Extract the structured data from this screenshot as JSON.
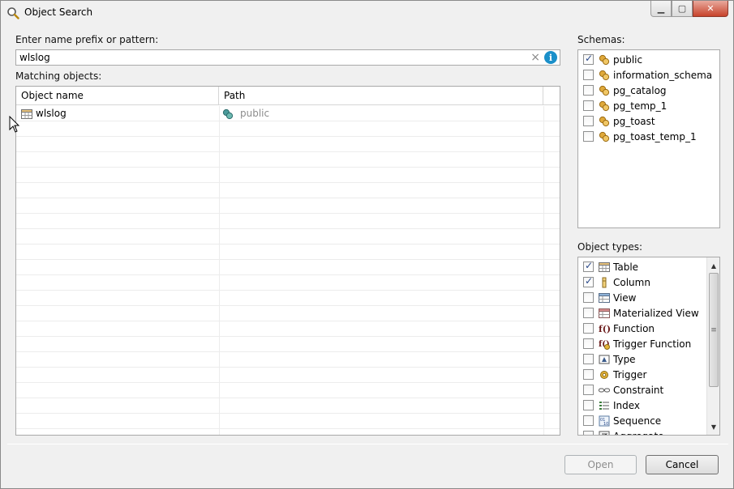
{
  "window": {
    "title": "Object Search"
  },
  "search": {
    "prompt_label": "Enter name prefix or pattern:",
    "value": "wlslog",
    "clear_symbol": "×",
    "info_symbol": "i"
  },
  "results": {
    "label": "Matching objects:",
    "columns": [
      "Object name",
      "Path"
    ],
    "rows": [
      {
        "name": "wlslog",
        "path": "public"
      }
    ]
  },
  "schemas": {
    "label": "Schemas:",
    "items": [
      {
        "label": "public",
        "checked": true,
        "icon": "schema-icon"
      },
      {
        "label": "information_schema",
        "checked": false,
        "icon": "schema-icon"
      },
      {
        "label": "pg_catalog",
        "checked": false,
        "icon": "schema-icon"
      },
      {
        "label": "pg_temp_1",
        "checked": false,
        "icon": "schema-icon"
      },
      {
        "label": "pg_toast",
        "checked": false,
        "icon": "schema-icon"
      },
      {
        "label": "pg_toast_temp_1",
        "checked": false,
        "icon": "schema-icon"
      }
    ]
  },
  "object_types": {
    "label": "Object types:",
    "items": [
      {
        "label": "Table",
        "checked": true,
        "icon": "table-icon"
      },
      {
        "label": "Column",
        "checked": true,
        "icon": "column-icon"
      },
      {
        "label": "View",
        "checked": false,
        "icon": "view-icon"
      },
      {
        "label": "Materialized View",
        "checked": false,
        "icon": "materialized-view-icon"
      },
      {
        "label": "Function",
        "checked": false,
        "icon": "function-icon"
      },
      {
        "label": "Trigger Function",
        "checked": false,
        "icon": "trigger-function-icon"
      },
      {
        "label": "Type",
        "checked": false,
        "icon": "type-icon"
      },
      {
        "label": "Trigger",
        "checked": false,
        "icon": "trigger-icon"
      },
      {
        "label": "Constraint",
        "checked": false,
        "icon": "constraint-icon"
      },
      {
        "label": "Index",
        "checked": false,
        "icon": "index-icon"
      },
      {
        "label": "Sequence",
        "checked": false,
        "icon": "sequence-icon"
      },
      {
        "label": "Aggregate",
        "checked": false,
        "icon": "aggregate-icon"
      }
    ]
  },
  "buttons": {
    "open": "Open",
    "cancel": "Cancel"
  }
}
